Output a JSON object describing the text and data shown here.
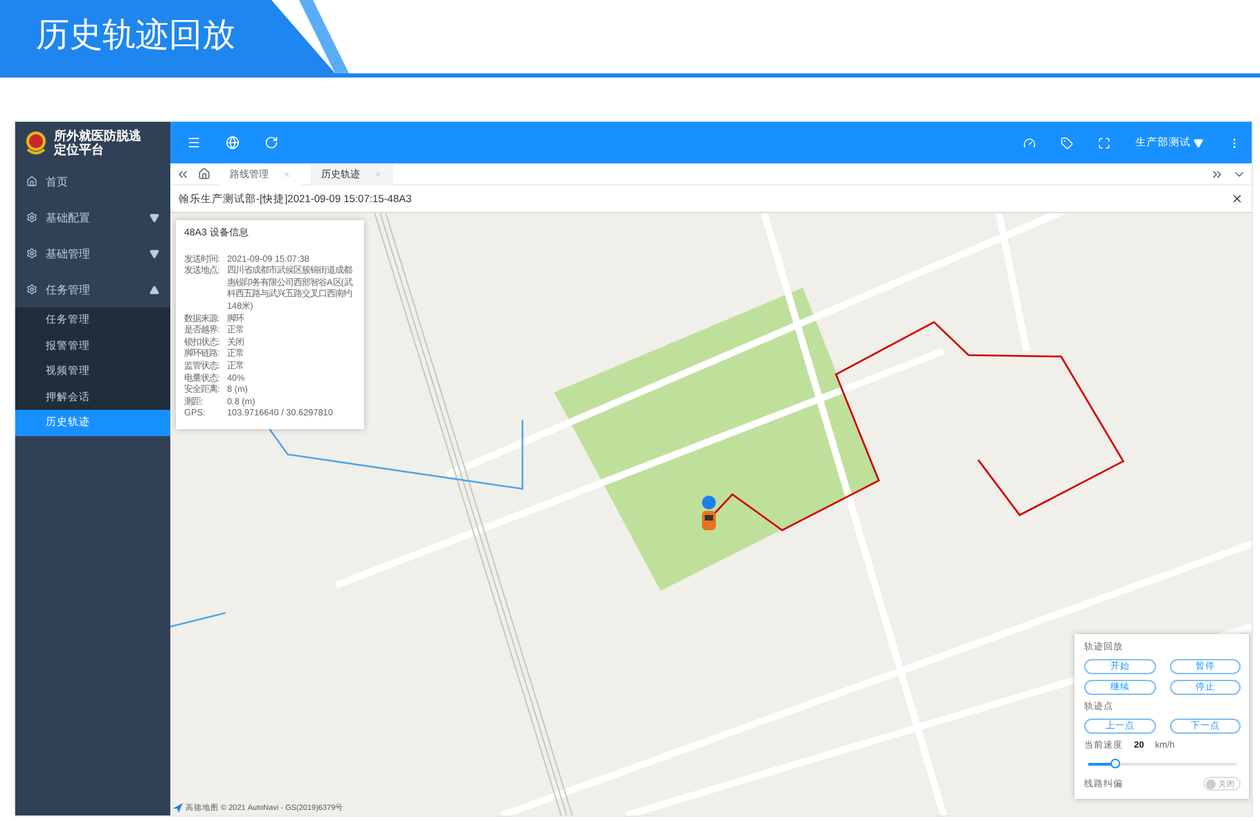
{
  "banner": {
    "title": "历史轨迹回放"
  },
  "app": {
    "logo_lines": [
      "所外就医防脱逃",
      "定位平台"
    ],
    "user": "生产部测试",
    "sidebar": [
      {
        "label": "首页",
        "kind": "home",
        "selected": false
      },
      {
        "label": "基础配置",
        "kind": "gear",
        "expanded": false,
        "selected": false
      },
      {
        "label": "基础管理",
        "kind": "gear",
        "expanded": false,
        "selected": false
      },
      {
        "label": "任务管理",
        "kind": "gear",
        "expanded": true,
        "selected": false,
        "children": [
          {
            "label": "任务管理",
            "selected": false
          },
          {
            "label": "报警管理",
            "selected": false
          },
          {
            "label": "视频管理",
            "selected": false
          },
          {
            "label": "押解会话",
            "selected": false
          },
          {
            "label": "历史轨迹",
            "selected": true
          }
        ]
      }
    ],
    "tabs": [
      {
        "label": "路线管理",
        "selected": false
      },
      {
        "label": "历史轨迹",
        "selected": true
      }
    ],
    "breadcrumb": "翰乐生产测试部-[快捷]2021-09-09 15:07:15-48A3"
  },
  "info_panel": {
    "title": "48A3 设备信息",
    "rows": [
      {
        "label": "发送时间:",
        "value": "2021-09-09 15:07:38"
      },
      {
        "label": "发送地点:",
        "value": "四川省成都市武侯区簇锦街道成都惠锐印务有限公司西部智谷A区(武科西五路与武兴五路交叉口西南约148米)"
      },
      {
        "label": "数据来源:",
        "value": "脚环"
      },
      {
        "label": "是否越界:",
        "value": "正常"
      },
      {
        "label": "锁扣状态:",
        "value": "关闭"
      },
      {
        "label": "脚环链路:",
        "value": "正常"
      },
      {
        "label": "监管状态:",
        "value": "正常"
      },
      {
        "label": "电量状态:",
        "value": "40%"
      },
      {
        "label": "安全距离:",
        "value": "8 (m)"
      },
      {
        "label": "测距:",
        "value": "0.8 (m)"
      },
      {
        "label": "GPS:",
        "value": "103.9716640 / 30.6297810"
      }
    ]
  },
  "controls": {
    "title": "轨迹回放",
    "buttons": [
      "开始",
      "暂停",
      "继续",
      "停止"
    ],
    "points_title": "轨迹点",
    "point_buttons": [
      "上一点",
      "下一点"
    ],
    "speed_label": "当前速度",
    "speed_value": "20",
    "speed_unit": "km/h",
    "speed_slider": {
      "level": 0.18
    },
    "correction": {
      "label": "线路纠偏",
      "on": false,
      "state_text": "关闭"
    }
  },
  "attribution": "高德地图 © 2021 AutoNavi - GS(2019)6379号"
}
